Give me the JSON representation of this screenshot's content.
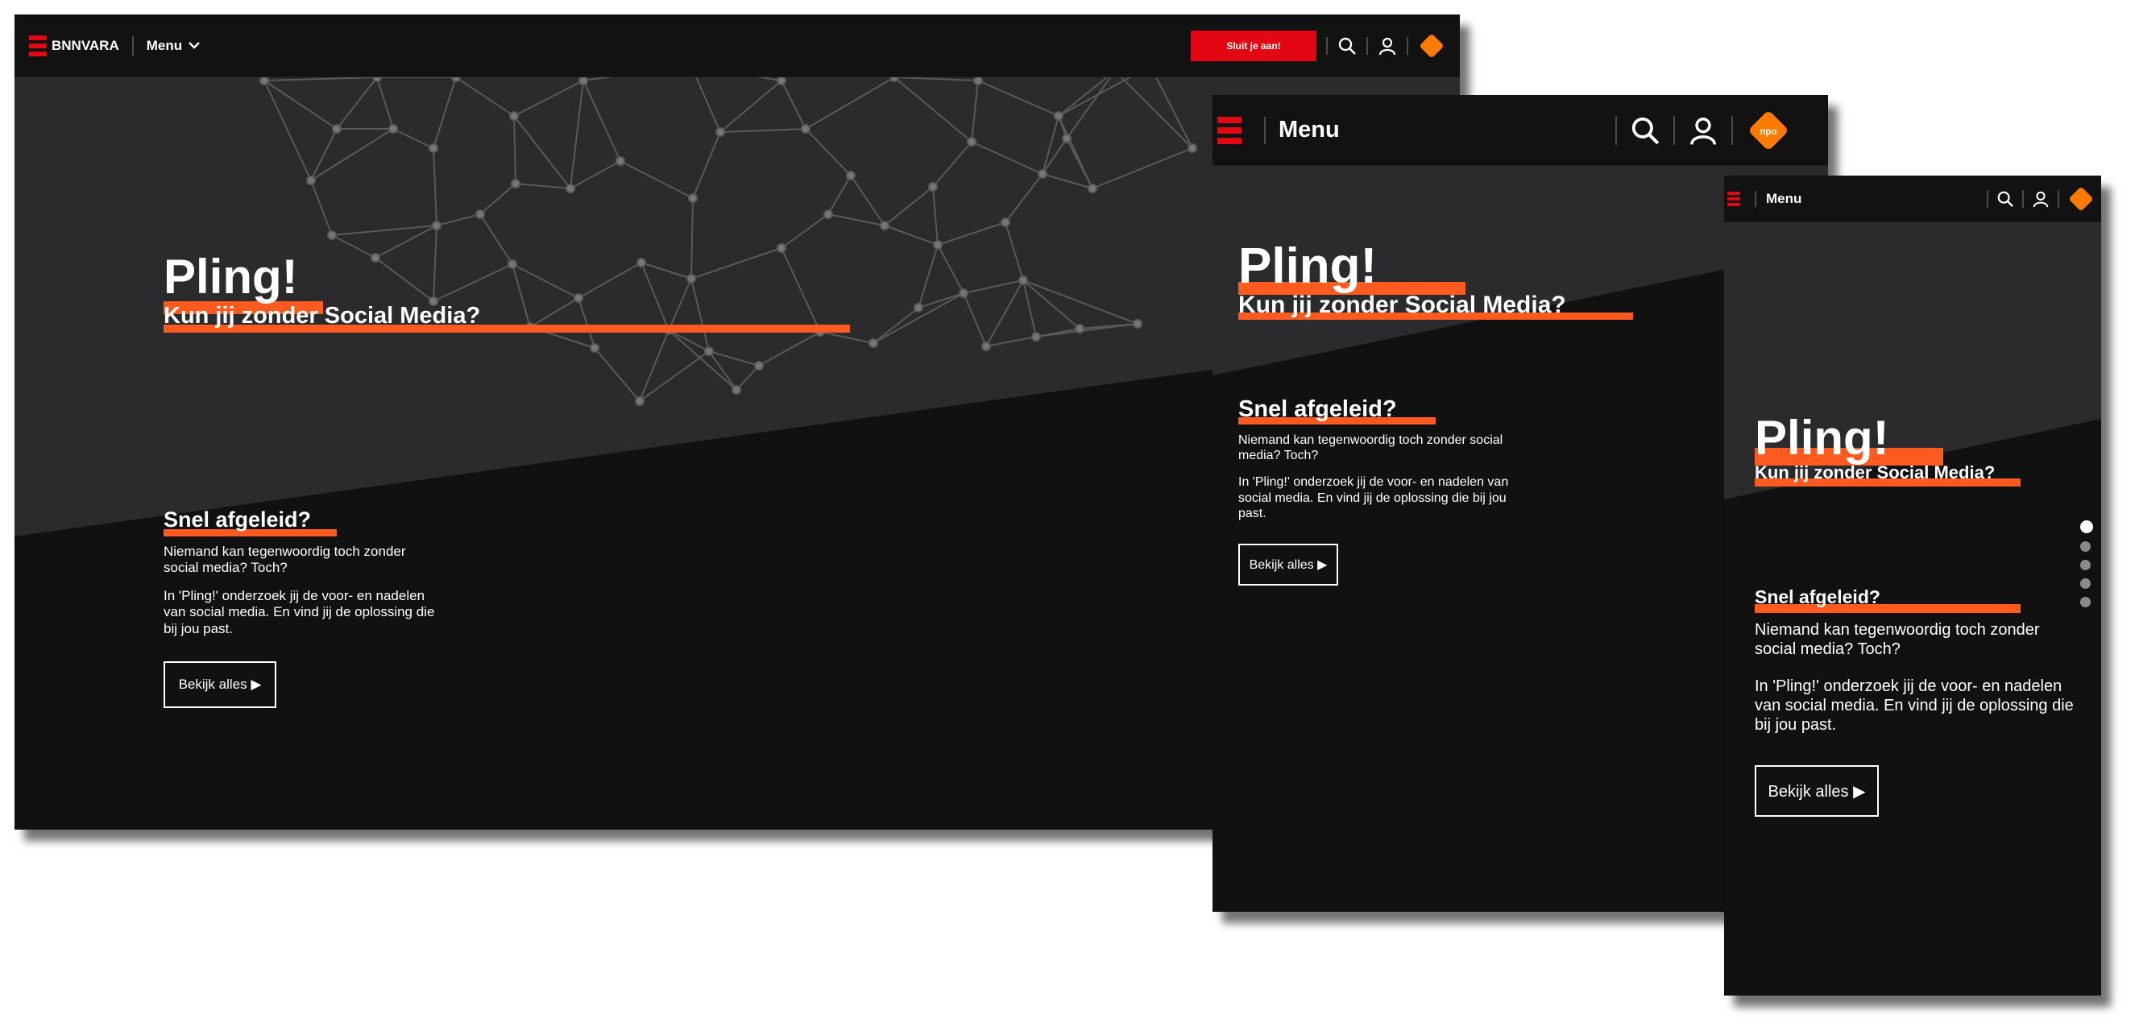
{
  "brand": {
    "name": "BNNVARA",
    "accent_color": "#ff5a1f",
    "brand_red": "#e30613",
    "npo_color": "#ff7a00",
    "npo_label": "npo"
  },
  "header": {
    "menu_label": "Menu",
    "cta_label": "Sluit je aan!",
    "icons": [
      "search-icon",
      "user-icon",
      "npo-logo"
    ]
  },
  "hero": {
    "title": "Pling!",
    "subtitle": "Kun jij zonder Social Media?"
  },
  "section": {
    "title": "Snel afgeleid?",
    "paragraph1": "Niemand kan tegenwoordig toch zonder social media? Toch?",
    "paragraph2": "In 'Pling!' onderzoek jij de voor- en nadelen van social media. En vind jij de oplossing die bij jou past.",
    "button_label": "Bekijk alles ▶"
  },
  "slider": {
    "dot_count": 5,
    "active_index": 0
  }
}
